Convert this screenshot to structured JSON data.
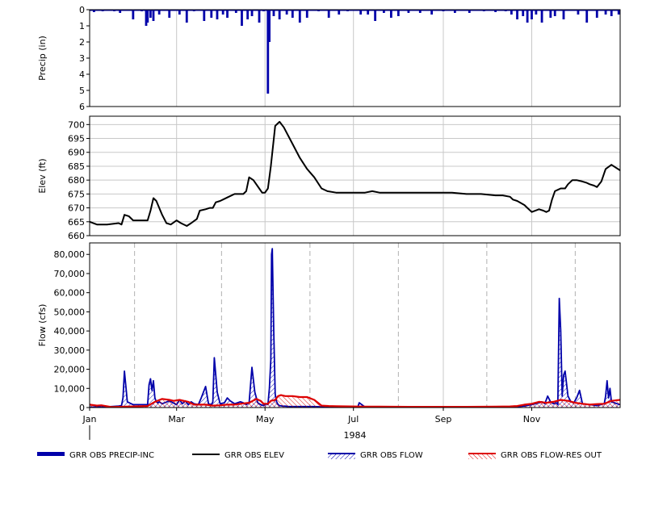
{
  "chart_data": {
    "type": "line",
    "xaxis": {
      "ticks": [
        "Jan",
        "Mar",
        "May",
        "Jul",
        "Sep",
        "Nov"
      ],
      "year": "1984",
      "range_days": [
        0,
        366
      ],
      "tick_days": [
        0,
        60,
        121,
        182,
        244,
        305
      ],
      "minor_grid_days": [
        31,
        91,
        152,
        213,
        274,
        335
      ]
    },
    "panels": [
      {
        "id": "precip",
        "type": "bar",
        "ylabel": "Precip (in)",
        "ylim": [
          0,
          6
        ],
        "inverted": true,
        "yticks": [
          "0",
          "1",
          "2",
          "3",
          "4",
          "5",
          "6"
        ],
        "ytick_values": [
          0,
          1,
          2,
          3,
          4,
          5,
          6
        ],
        "series": [
          {
            "name": "GRR OBS PRECIP-INC",
            "color": "#0000aa",
            "day": [
              3,
              9,
              17,
              21,
              30,
              36,
              39,
              40,
              42,
              44,
              48,
              55,
              62,
              67,
              72,
              79,
              84,
              88,
              92,
              95,
              101,
              105,
              109,
              112,
              117,
              120,
              123,
              124,
              127,
              131,
              136,
              140,
              145,
              150,
              158,
              165,
              172,
              178,
              187,
              192,
              197,
              203,
              208,
              213,
              220,
              228,
              236,
              244,
              252,
              262,
              272,
              280,
              287,
              291,
              295,
              299,
              302,
              305,
              308,
              312,
              318,
              321,
              327,
              337,
              343,
              350,
              356,
              360,
              365
            ],
            "values": [
              0.15,
              0.1,
              0.1,
              0.2,
              0.6,
              0.1,
              1.0,
              0.8,
              0.5,
              0.7,
              0.3,
              0.5,
              0.3,
              0.8,
              0.1,
              0.7,
              0.5,
              0.6,
              0.3,
              0.5,
              0.2,
              1.0,
              0.6,
              0.4,
              0.8,
              0.1,
              5.2,
              2.0,
              0.4,
              0.6,
              0.3,
              0.5,
              0.8,
              0.5,
              0.1,
              0.5,
              0.3,
              0.1,
              0.3,
              0.3,
              0.7,
              0.2,
              0.5,
              0.4,
              0.2,
              0.2,
              0.3,
              0.1,
              0.2,
              0.2,
              0.1,
              0.15,
              0.1,
              0.3,
              0.6,
              0.4,
              0.8,
              0.6,
              0.3,
              0.8,
              0.5,
              0.4,
              0.6,
              0.3,
              0.8,
              0.5,
              0.3,
              0.4,
              0.3
            ]
          }
        ]
      },
      {
        "id": "elev",
        "type": "line",
        "ylabel": "Elev (ft)",
        "ylim": [
          660,
          703
        ],
        "yticks": [
          "660",
          "665",
          "670",
          "675",
          "680",
          "685",
          "690",
          "695",
          "700"
        ],
        "ytick_values": [
          660,
          665,
          670,
          675,
          680,
          685,
          690,
          695,
          700
        ],
        "series": [
          {
            "name": "GRR OBS ELEV",
            "color": "#000000",
            "day": [
              0,
              5,
              12,
              20,
              22,
              24,
              27,
              30,
              33,
              40,
              42,
              44,
              46,
              50,
              53,
              56,
              60,
              63,
              67,
              70,
              74,
              76,
              80,
              83,
              85,
              87,
              90,
              92,
              96,
              100,
              104,
              106,
              108,
              110,
              113,
              117,
              119,
              121,
              123,
              125,
              128,
              131,
              134,
              140,
              145,
              150,
              155,
              160,
              164,
              170,
              180,
              190,
              195,
              200,
              210,
              230,
              250,
              260,
              270,
              280,
              285,
              290,
              292,
              295,
              300,
              302,
              305,
              310,
              313,
              315,
              317,
              319,
              321,
              323,
              325,
              328,
              330,
              333,
              336,
              340,
              343,
              345,
              348,
              350,
              353,
              356,
              360,
              363,
              366
            ],
            "values": [
              665,
              664,
              664,
              664.5,
              664,
              667.5,
              667,
              665.5,
              665.5,
              665.5,
              669,
              673.5,
              672.5,
              667.5,
              664.5,
              664,
              665.5,
              664.5,
              663.5,
              664.5,
              666,
              669,
              669.5,
              670,
              670,
              672,
              672.5,
              673,
              674,
              675,
              675,
              675,
              676,
              681,
              680,
              677,
              675.5,
              675.5,
              677,
              685,
              699.5,
              701,
              699,
              693,
              688,
              684,
              681,
              677,
              676,
              675.5,
              675.5,
              675.5,
              676,
              675.5,
              675.5,
              675.5,
              675.5,
              675,
              675,
              674.5,
              674.5,
              674,
              673,
              672.5,
              671,
              670,
              668.5,
              669.5,
              669,
              668.5,
              669,
              673,
              676,
              676.5,
              677,
              677,
              678.5,
              680,
              680,
              679.5,
              679,
              678.5,
              678,
              677.5,
              679.5,
              684,
              685.5,
              684.5,
              683.5
            ]
          }
        ]
      },
      {
        "id": "flow",
        "type": "line",
        "ylabel": "Flow (cfs)",
        "ylim": [
          0,
          86000
        ],
        "yticks": [
          "0",
          "10,000",
          "20,000",
          "30,000",
          "40,000",
          "50,000",
          "60,000",
          "70,000",
          "80,000"
        ],
        "ytick_values": [
          0,
          10000,
          20000,
          30000,
          40000,
          50000,
          60000,
          70000,
          80000
        ],
        "series": [
          {
            "name": "GRR OBS FLOW",
            "color": "#0000aa",
            "fill": "hatch",
            "day": [
              0,
              10,
              15,
              20,
              22,
              23,
              24,
              26,
              30,
              40,
              41,
              42,
              43,
              44,
              45,
              46,
              47,
              48,
              50,
              55,
              60,
              62,
              64,
              66,
              68,
              70,
              72,
              75,
              77,
              80,
              82,
              84,
              85,
              86,
              88,
              90,
              93,
              95,
              97,
              100,
              104,
              106,
              108,
              110,
              112,
              114,
              116,
              118,
              120,
              122,
              123,
              124,
              125,
              125.5,
              126,
              127,
              128,
              129,
              130,
              131,
              133,
              135,
              137,
              140,
              145,
              150,
              155,
              160,
              170,
              180,
              185,
              186,
              190,
              200,
              210,
              230,
              250,
              270,
              290,
              295,
              300,
              305,
              310,
              312,
              314,
              316,
              318,
              320,
              322,
              323,
              324,
              325,
              326,
              327,
              328,
              330,
              332,
              334,
              336,
              338,
              340,
              345,
              350,
              355,
              356,
              357,
              358,
              359,
              360,
              362,
              364,
              366
            ],
            "values": [
              200,
              300,
              500,
              800,
              1000,
              5000,
              19000,
              3000,
              1500,
              1500,
              12000,
              15000,
              9000,
              14000,
              5000,
              3000,
              2500,
              3000,
              2000,
              3500,
              1500,
              4000,
              2000,
              3500,
              1500,
              3000,
              2000,
              1500,
              5000,
              11000,
              2000,
              1500,
              3000,
              26000,
              8000,
              2000,
              2500,
              5000,
              3500,
              2000,
              3000,
              2500,
              1500,
              2500,
              21000,
              8000,
              2500,
              1500,
              1000,
              2000,
              1500,
              10000,
              25000,
              80000,
              83000,
              40000,
              7000,
              3000,
              1500,
              1000,
              800,
              700,
              600,
              500,
              500,
              500,
              500,
              400,
              400,
              400,
              300,
              2500,
              300,
              300,
              300,
              200,
              200,
              200,
              300,
              500,
              800,
              1500,
              2500,
              3000,
              2000,
              6000,
              3000,
              2000,
              2500,
              1500,
              57000,
              40000,
              6000,
              17000,
              19000,
              6000,
              3000,
              2500,
              5000,
              9000,
              2000,
              1500,
              1000,
              2000,
              6000,
              14000,
              5000,
              10000,
              3000,
              2500,
              2000,
              1500
            ]
          },
          {
            "name": "GRR OBS FLOW-RES OUT",
            "color": "#dd0000",
            "fill": "hatch",
            "day": [
              0,
              5,
              8,
              15,
              25,
              30,
              40,
              45,
              50,
              55,
              58,
              62,
              65,
              68,
              72,
              80,
              85,
              90,
              95,
              100,
              104,
              110,
              115,
              118,
              120,
              123,
              125,
              128,
              130,
              132,
              135,
              140,
              145,
              150,
              155,
              160,
              165,
              170,
              180,
              190,
              200,
              220,
              240,
              260,
              280,
              290,
              295,
              300,
              305,
              310,
              315,
              320,
              325,
              330,
              335,
              340,
              345,
              350,
              355,
              360,
              366
            ],
            "values": [
              1500,
              1000,
              1200,
              300,
              500,
              600,
              800,
              3000,
              4500,
              4000,
              3500,
              4000,
              3500,
              3000,
              1500,
              1500,
              1000,
              1200,
              1500,
              1500,
              2000,
              2500,
              4500,
              3500,
              2000,
              2000,
              3500,
              4000,
              6000,
              6500,
              6000,
              6000,
              5500,
              5500,
              4000,
              1000,
              800,
              700,
              600,
              500,
              500,
              400,
              400,
              400,
              500,
              600,
              800,
              1500,
              2000,
              3000,
              2500,
              3000,
              4000,
              3500,
              2500,
              2000,
              1500,
              1800,
              2000,
              3500,
              4000
            ]
          }
        ]
      }
    ],
    "legend": {
      "position": "bottom",
      "items": [
        {
          "label": "GRR OBS PRECIP-INC",
          "color": "#0000aa",
          "style": "thick-bar"
        },
        {
          "label": "GRR OBS ELEV",
          "color": "#000000",
          "style": "line"
        },
        {
          "label": "GRR OBS FLOW",
          "color": "#0000aa",
          "style": "hatch"
        },
        {
          "label": "GRR OBS FLOW-RES OUT",
          "color": "#dd0000",
          "style": "hatch"
        }
      ]
    }
  }
}
